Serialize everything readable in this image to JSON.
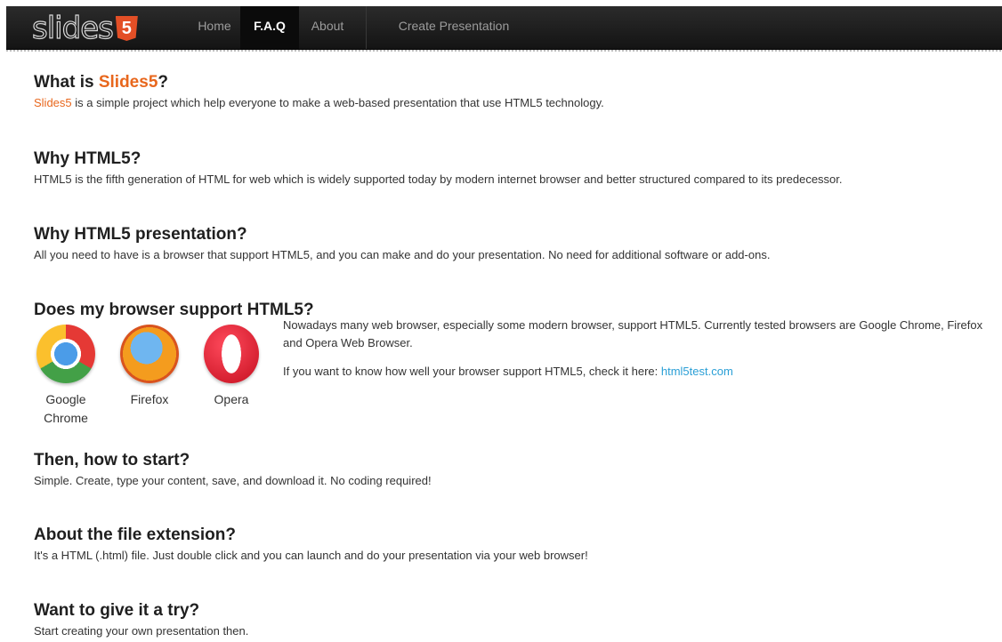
{
  "brand": {
    "text": "slides",
    "badge": "5"
  },
  "nav": {
    "items": [
      {
        "label": "Home",
        "active": false
      },
      {
        "label": "F.A.Q",
        "active": true
      },
      {
        "label": "About",
        "active": false
      },
      {
        "label": "Create Presentation",
        "active": false
      }
    ]
  },
  "faq": {
    "q1": {
      "title_prefix": "What is ",
      "title_accent": "Slides5",
      "title_suffix": "?",
      "body_accent": "Slides5",
      "body": " is a simple project which help everyone to make a web-based presentation that use HTML5 technology."
    },
    "q2": {
      "title": "Why HTML5?",
      "body": "HTML5 is the fifth generation of HTML for web which is widely supported today by modern internet browser and better structured compared to its predecessor."
    },
    "q3": {
      "title": "Why HTML5 presentation?",
      "body": "All you need to have is a browser that support HTML5, and you can make and do your presentation. No need for additional software or add-ons."
    },
    "q4": {
      "title": "Does my browser support HTML5?",
      "browsers": [
        {
          "label": "Google Chrome",
          "icon": "chrome-icon"
        },
        {
          "label": "Firefox",
          "icon": "firefox-icon"
        },
        {
          "label": "Opera",
          "icon": "opera-icon"
        }
      ],
      "body1": "Nowadays many web browser, especially some modern browser, support HTML5. Currently tested browsers are Google Chrome, Firefox and Opera Web Browser.",
      "body2_prefix": "If you want to know how well your browser support HTML5, check it here: ",
      "link": "html5test.com"
    },
    "q5": {
      "title": "Then, how to start?",
      "body": "Simple. Create, type your content, save, and download it. No coding required!"
    },
    "q6": {
      "title": "About the file extension?",
      "body": "It's a HTML (.html) file. Just double click and you can launch and do your presentation via your web browser!"
    },
    "q7": {
      "title": "Want to give it a try?",
      "body": "Start creating your own presentation then."
    }
  }
}
